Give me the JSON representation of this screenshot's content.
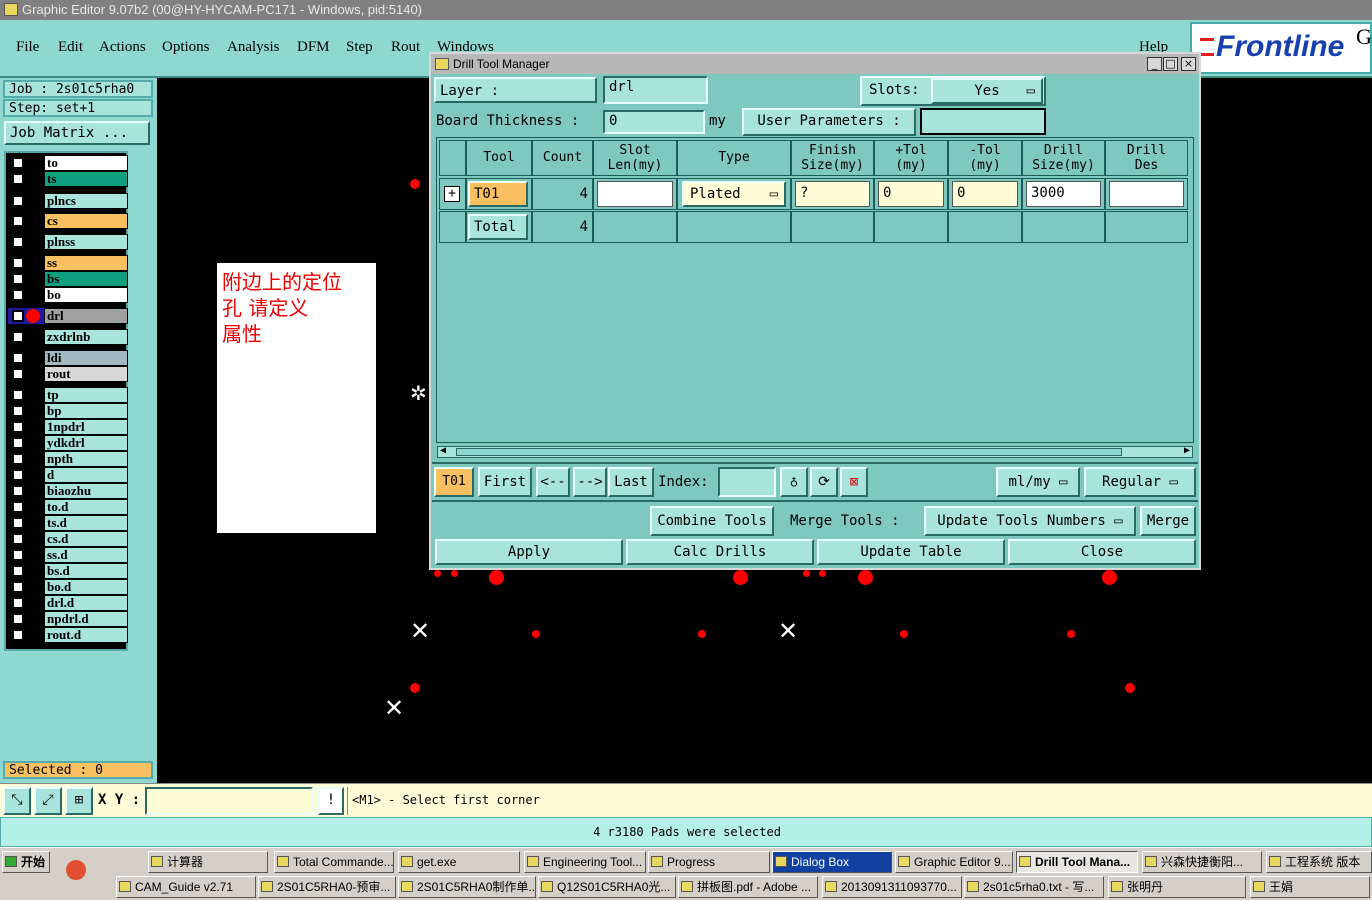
{
  "window": {
    "title": "Graphic Editor 9.07b2 (00@HY-HYCAM-PC171 - Windows, pid:5140)"
  },
  "menu": {
    "file": "File",
    "edit": "Edit",
    "actions": "Actions",
    "options": "Options",
    "analysis": "Analysis",
    "dfm": "DFM",
    "step": "Step",
    "rout": "Rout",
    "windows": "Windows",
    "help": "Help"
  },
  "logo": {
    "text": "Frontline",
    "suffix": "G"
  },
  "left": {
    "job": "Job : 2s01c5rha0",
    "step": "Step: set+1",
    "job_matrix": "Job Matrix ...",
    "selected": "Selected : 0",
    "layers": [
      "to",
      "ts",
      "plncs",
      "cs",
      "plnss",
      "ss",
      "bs",
      "bo",
      "drl",
      "zxdrlnb",
      "ldi",
      "rout",
      "tp",
      "bp",
      "1npdrl",
      "ydkdrl",
      "npth",
      "d",
      "biaozhu",
      "to.d",
      "ts.d",
      "cs.d",
      "ss.d",
      "bs.d",
      "bo.d",
      "drl.d",
      "npdrl.d",
      "rout.d"
    ]
  },
  "note": {
    "line1": "附边上的定位",
    "line2": "孔  请定义",
    "line3": "属性"
  },
  "dialog": {
    "title": "Drill Tool Manager",
    "layer_label": "Layer       :",
    "layer_value": "drl",
    "slots_label": "Slots:",
    "slots_value": "Yes",
    "board_label": "Board Thickness :",
    "board_value": "0",
    "board_unit": "my",
    "user_params": "User Parameters :",
    "headers": {
      "tool": "Tool",
      "count": "Count",
      "slot1": "Slot",
      "slot2": "Len(my)",
      "type": "Type",
      "finish1": "Finish",
      "finish2": "Size(my)",
      "ptol1": "+Tol",
      "ptol2": "(my)",
      "mtol1": "-Tol",
      "mtol2": "(my)",
      "drill1": "Drill",
      "drill2": "Size(my)",
      "des1": "Drill",
      "des2": "Des"
    },
    "row": {
      "tool": "T01",
      "count": "4",
      "type": "Plated",
      "finish": "?",
      "ptol": "0",
      "mtol": "0",
      "drill": "3000"
    },
    "total": {
      "label": "Total",
      "count": "4"
    },
    "nav": {
      "current": "T01",
      "first": "First",
      "prev": "<--",
      "next": "-->",
      "last": "Last",
      "index": "Index:",
      "units": "ml/my",
      "mode": "Regular"
    },
    "actions": {
      "combine": "Combine Tools",
      "merge_label": "Merge Tools :",
      "update_numbers": "Update Tools Numbers",
      "merge": "Merge",
      "apply": "Apply",
      "calc": "Calc Drills",
      "update_table": "Update Table",
      "close": "Close"
    }
  },
  "status": {
    "xy": "X Y :",
    "prompt": "<M1> - Select first corner",
    "message": "4 r3180 Pads were selected"
  },
  "taskbar": {
    "start": "开始",
    "row1": [
      "计算器",
      "Total Commande...",
      "get.exe",
      "Engineering Tool...",
      "Progress",
      "Dialog Box",
      "Graphic Editor 9....",
      "Drill Tool Mana...",
      "兴森快捷衡阳...",
      "工程系统  版本"
    ],
    "row2": [
      "CAM_Guide v2.71",
      "2S01C5RHA0-预审...",
      "2S01C5RHA0制作单...",
      "Q12S01C5RHA0光...",
      "拼板图.pdf - Adobe ...",
      "2013091311093770...",
      "2s01c5rha0.txt - 写...",
      "张明丹",
      "王娟"
    ]
  }
}
